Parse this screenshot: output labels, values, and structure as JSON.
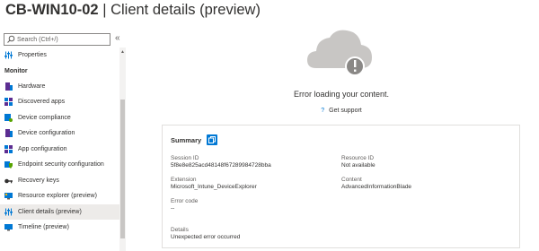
{
  "header": {
    "resource": "CB-WIN10-02",
    "separator": " | ",
    "page": "Client details (preview)"
  },
  "sidebar": {
    "search_placeholder": "Search (Ctrl+/)",
    "collapse_glyph": "«",
    "top_item": {
      "label": "Properties",
      "icon": "properties-icon"
    },
    "section": "Monitor",
    "items": [
      {
        "label": "Hardware",
        "icon": "hardware-icon"
      },
      {
        "label": "Discovered apps",
        "icon": "discovered-apps-icon"
      },
      {
        "label": "Device compliance",
        "icon": "device-compliance-icon"
      },
      {
        "label": "Device configuration",
        "icon": "device-configuration-icon"
      },
      {
        "label": "App configuration",
        "icon": "app-configuration-icon"
      },
      {
        "label": "Endpoint security configuration",
        "icon": "endpoint-security-icon"
      },
      {
        "label": "Recovery keys",
        "icon": "key-icon"
      },
      {
        "label": "Resource explorer (preview)",
        "icon": "resource-explorer-icon"
      },
      {
        "label": "Client details (preview)",
        "icon": "client-details-icon",
        "selected": true
      },
      {
        "label": "Timeline (preview)",
        "icon": "timeline-icon"
      }
    ]
  },
  "main": {
    "error_message": "Error loading your content.",
    "support_label": "Get support",
    "summary": {
      "title": "Summary",
      "session_id_label": "Session ID",
      "session_id_value": "5f8e8e825acd48148f67289984728bba",
      "resource_id_label": "Resource ID",
      "resource_id_value": "Not available",
      "extension_label": "Extension",
      "extension_value": "Microsoft_Intune_DeviceExplorer",
      "content_label": "Content",
      "content_value": "AdvancedInformationBlade",
      "error_code_label": "Error code",
      "error_code_value": "--",
      "details_label": "Details",
      "details_value": "Unexpected error occurred"
    }
  },
  "colors": {
    "accent": "#0078d4",
    "selected_bg": "#edebe9",
    "cloud": "#c8c6c4",
    "cloud_badge": "#8a8886"
  }
}
